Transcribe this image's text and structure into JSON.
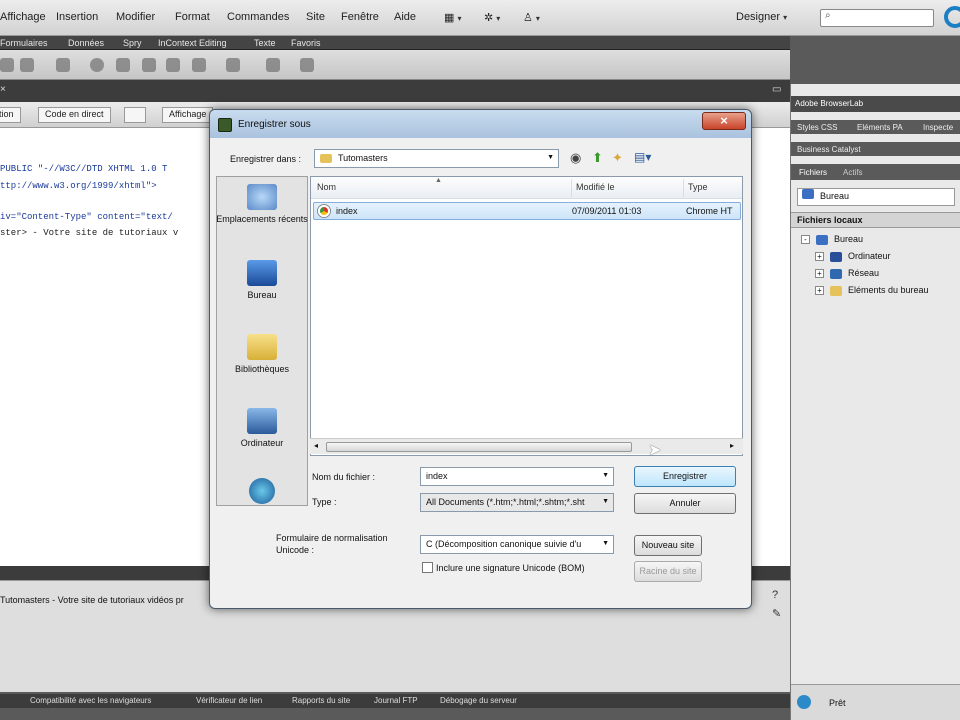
{
  "menubar": {
    "items": [
      "Affichage",
      "Insertion",
      "Modifier",
      "Format",
      "Commandes",
      "Site",
      "Fenêtre",
      "Aide"
    ],
    "workspace": "Designer"
  },
  "insertbar": {
    "tabs": [
      "Formulaires",
      "Données",
      "Spry",
      "InContext Editing",
      "Texte",
      "Favoris"
    ]
  },
  "docbar": {
    "live_code": "Code en direct",
    "view": "Affichage"
  },
  "code": {
    "lines": [
      "PUBLIC \"-//W3C//DTD XHTML 1.0 T",
      "ttp://www.w3.org/1999/xhtml\">",
      "iv=\"Content-Type\" content=\"text/",
      "ster> - Votre site de tutoriaux v"
    ]
  },
  "status": {
    "title_line": "Tutomasters - Votre site de tutoriaux vidéos pr",
    "ready": "Prêt"
  },
  "bottomtabs": [
    "Compatibilité avec les navigateurs",
    "Vérificateur de lien",
    "Rapports du site",
    "Journal FTP",
    "Débogage du serveur"
  ],
  "rpanel": {
    "browserlab": "Adobe BrowserLab",
    "tabs": [
      "Styles CSS",
      "Eléments PA",
      "Inspecte"
    ],
    "catalyst": "Business Catalyst",
    "file_tabs": [
      "Fichiers",
      "Actifs"
    ],
    "location": "Bureau",
    "local_files": "Fichiers locaux",
    "tree": [
      {
        "label": "Bureau",
        "level": 0,
        "exp": "-"
      },
      {
        "label": "Ordinateur",
        "level": 1,
        "exp": "+"
      },
      {
        "label": "Réseau",
        "level": 1,
        "exp": "+"
      },
      {
        "label": "Eléments du bureau",
        "level": 1,
        "exp": "+"
      }
    ]
  },
  "dialog": {
    "title": "Enregistrer sous",
    "save_in_label": "Enregistrer dans :",
    "folder": "Tutomasters",
    "places": [
      "Emplacements récents",
      "Bureau",
      "Bibliothèques",
      "Ordinateur"
    ],
    "columns": [
      "Nom",
      "Modifié le",
      "Type"
    ],
    "files": [
      {
        "name": "index",
        "modified": "07/09/2011 01:03",
        "type": "Chrome HT"
      }
    ],
    "filename_label": "Nom du fichier :",
    "filename": "index",
    "type_label": "Type :",
    "filetype": "All Documents (*.htm;*.html;*.shtm;*.sht",
    "normalization_label": "Formulaire de normalisation Unicode :",
    "normalization": "C (Décomposition canonique suivie d'u",
    "bom_label": "Inclure une signature Unicode (BOM)",
    "buttons": {
      "save": "Enregistrer",
      "cancel": "Annuler",
      "new_site": "Nouveau site",
      "site_root": "Racine du site"
    }
  }
}
